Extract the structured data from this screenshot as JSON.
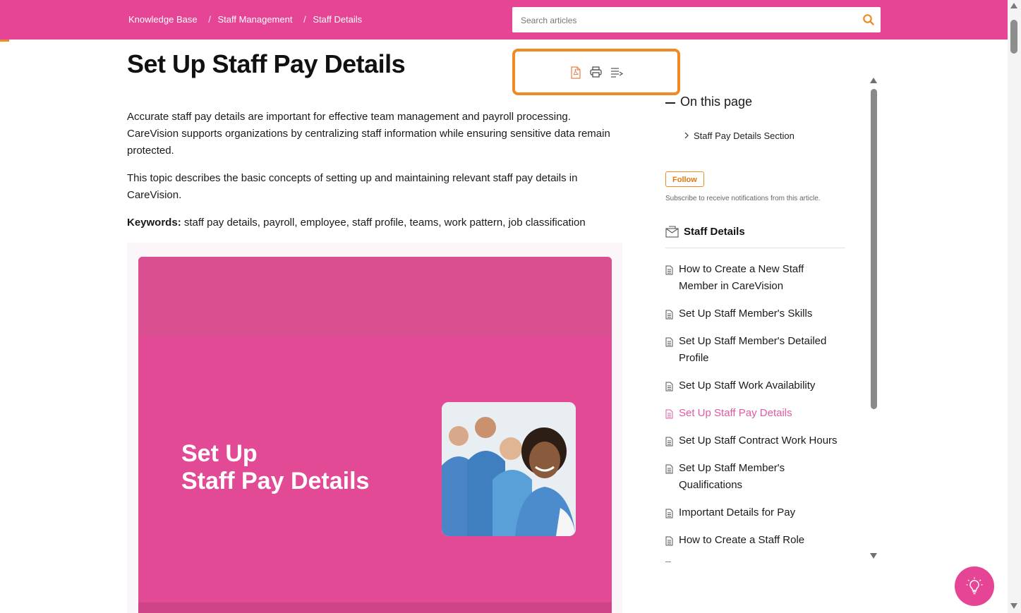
{
  "breadcrumb": {
    "items": [
      "Knowledge Base",
      "Staff Management",
      "Staff Details"
    ],
    "separator": "/"
  },
  "search": {
    "placeholder": "Search articles"
  },
  "article": {
    "title": "Set Up Staff Pay Details",
    "paragraph1": "Accurate staff pay details are important for effective team management and payroll processing. CareVision supports organizations by centralizing staff information while ensuring sensitive data remain protected.",
    "paragraph2": "This topic describes the basic concepts of setting up and maintaining relevant staff pay details in CareVision.",
    "keywords_label": "Keywords:",
    "keywords_value": " staff pay details, payroll, employee, staff profile, teams, work pattern, job classification",
    "hero_title_line1": "Set Up",
    "hero_title_line2": "Staff Pay Details"
  },
  "toolbar": {
    "icons": [
      "pdf-icon",
      "print-icon",
      "outline-icon"
    ]
  },
  "on_this_page": {
    "title": "On this page",
    "items": [
      "Staff Pay Details Section"
    ]
  },
  "follow": {
    "button_label": "Follow",
    "note": "Subscribe to receive notifications from this article."
  },
  "staff_details": {
    "title": "Staff Details",
    "items": [
      "How to Create a New Staff Member in CareVision",
      "Set Up Staff Member's Skills",
      "Set Up Staff Member's Detailed Profile",
      "Set Up Staff Work Availability",
      "Set Up Staff Pay Details",
      "Set Up Staff Contract Work Hours",
      "Set Up Staff Member's Qualifications",
      "Important Details for Pay",
      "How to Create a Staff Role"
    ],
    "active_index": 4
  },
  "colors": {
    "brand": "#e64595",
    "accent_orange": "#f08a24",
    "active_link": "#e05aa0"
  }
}
